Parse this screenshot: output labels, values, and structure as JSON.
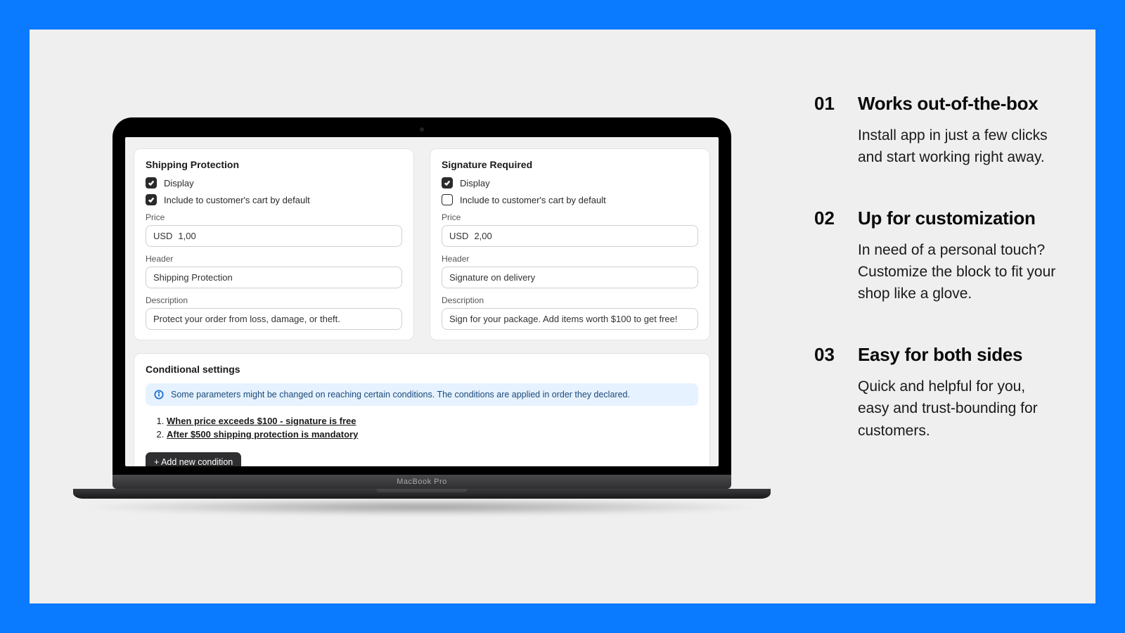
{
  "laptop_label": "MacBook Pro",
  "admin": {
    "shipping": {
      "title": "Shipping Protection",
      "display_label": "Display",
      "display_checked": true,
      "include_label": "Include to customer's cart by default",
      "include_checked": true,
      "price_label": "Price",
      "price_currency": "USD",
      "price_value": "1,00",
      "header_label": "Header",
      "header_value": "Shipping Protection",
      "desc_label": "Description",
      "desc_value": "Protect your order from loss, damage, or theft."
    },
    "signature": {
      "title": "Signature Required",
      "display_label": "Display",
      "display_checked": true,
      "include_label": "Include to customer's cart by default",
      "include_checked": false,
      "price_label": "Price",
      "price_currency": "USD",
      "price_value": "2,00",
      "header_label": "Header",
      "header_value": "Signature on delivery",
      "desc_label": "Description",
      "desc_value": "Sign for your package. Add items worth $100 to get free!"
    },
    "conditions": {
      "title": "Conditional settings",
      "alert": "Some parameters might be changed on reaching certain conditions. The conditions are applied in order they declared.",
      "items": [
        "When price exceeds $100 - signature is free",
        "After $500 shipping protection is mandatory"
      ],
      "add_label": "+ Add new condition"
    }
  },
  "features": [
    {
      "num": "01",
      "title": "Works out-of-the-box",
      "body": "Install app in just a few clicks and start working right away."
    },
    {
      "num": "02",
      "title": "Up for customization",
      "body": "In need of a personal touch? Customize the block to fit your shop like a glove."
    },
    {
      "num": "03",
      "title": "Easy for both sides",
      "body": "Quick and helpful for you, easy and trust-bounding for customers."
    }
  ]
}
